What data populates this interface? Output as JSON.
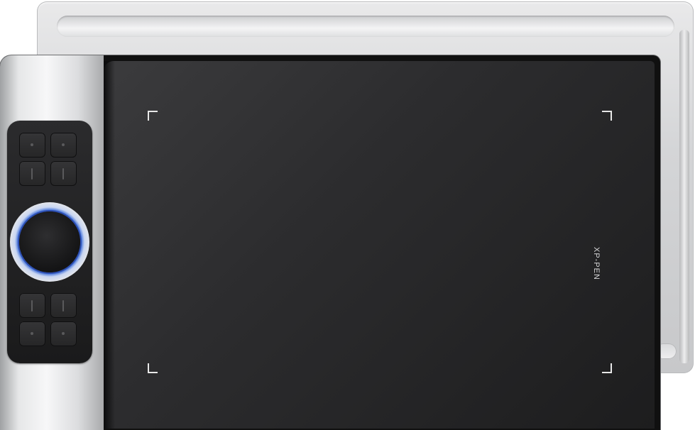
{
  "product": {
    "brand_label": "XP-PEN",
    "accent_color": "#3f6fd8",
    "body_color": "#1d1d1e",
    "frame_color": "#e6e7e8"
  },
  "express_keys": {
    "top_group": [
      "key-dot",
      "key-dot",
      "key-bar",
      "key-bar"
    ],
    "bottom_group": [
      "key-bar",
      "key-bar",
      "key-dot",
      "key-dot"
    ]
  }
}
